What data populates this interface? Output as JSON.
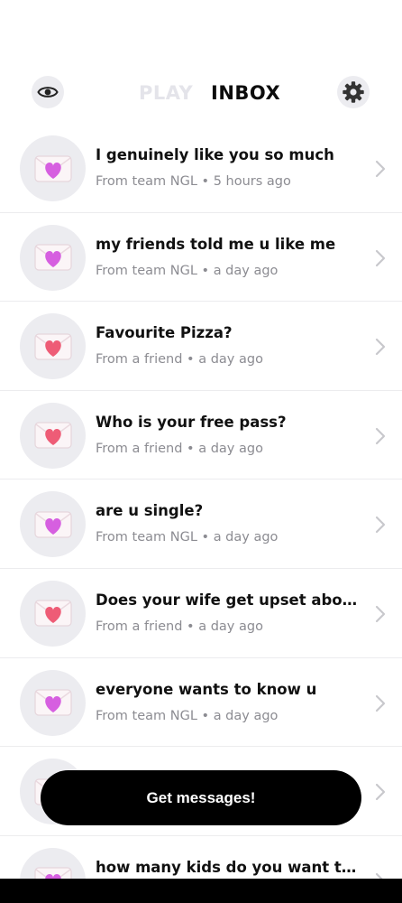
{
  "header": {
    "tab_play": "PLAY",
    "tab_inbox": "INBOX",
    "left_icon": "eye-icon",
    "right_icon": "gear-icon"
  },
  "messages": [
    {
      "title": "I genuinely like you so much",
      "subtitle": "From team NGL • 5 hours ago",
      "heart_color": "#d65fe0"
    },
    {
      "title": "my friends told me u like me",
      "subtitle": "From team NGL • a day ago",
      "heart_color": "#d65fe0"
    },
    {
      "title": "Favourite Pizza?",
      "subtitle": "From a friend • a day ago",
      "heart_color": "#ee5c76"
    },
    {
      "title": "Who is your free pass?",
      "subtitle": "From a friend • a day ago",
      "heart_color": "#ee5c76"
    },
    {
      "title": "are u single?",
      "subtitle": "From team NGL • a day ago",
      "heart_color": "#d65fe0"
    },
    {
      "title": "Does your wife get upset about p...",
      "subtitle": "From a friend • a day ago",
      "heart_color": "#ee5c76"
    },
    {
      "title": "everyone wants to know u",
      "subtitle": "From team NGL • a day ago",
      "heart_color": "#d65fe0"
    },
    {
      "title": "",
      "subtitle": "",
      "heart_color": "#d65fe0"
    },
    {
      "title": "how many kids do you want to ha...",
      "subtitle": "",
      "heart_color": "#d65fe0"
    }
  ],
  "cta": {
    "label": "Get messages!"
  },
  "colors": {
    "accent": "#000000",
    "muted_text": "#8c8c92",
    "tab_inactive": "#e4e4ea"
  }
}
